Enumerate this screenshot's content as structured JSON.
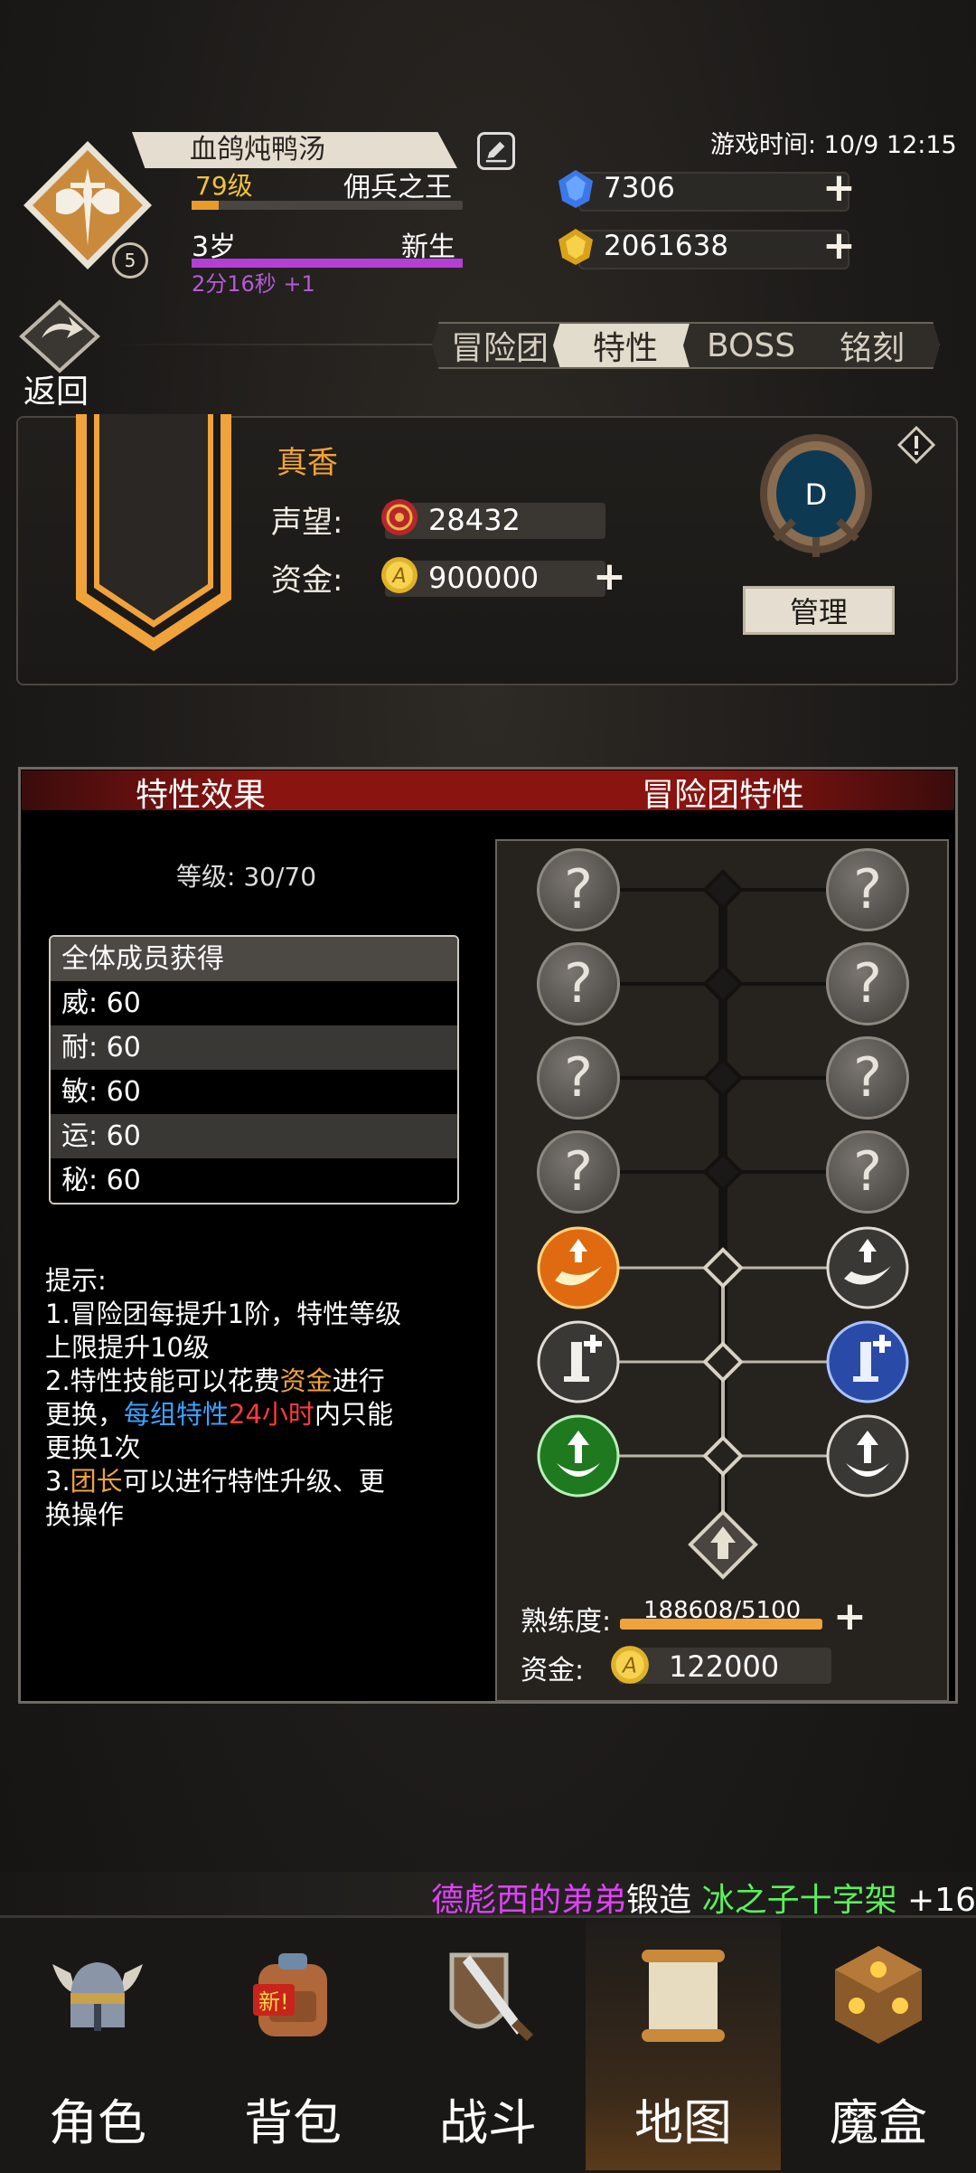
{
  "player": {
    "name": "血鸽炖鸭汤",
    "level": "79级",
    "title": "佣兵之王",
    "rank_badge": "5",
    "age": "3岁",
    "age_status": "新生",
    "timer": "2分16秒 +1",
    "xp_fraction": 0.1
  },
  "game_time": "游戏时间: 10/9 12:15",
  "resources": {
    "gems": "7306",
    "gold": "2061638"
  },
  "back_label": "返回",
  "tabs": [
    "冒险团",
    "特性",
    "BOSS",
    "铭刻"
  ],
  "active_tab": "特性",
  "team": {
    "name": "真香",
    "reputation_label": "声望:",
    "reputation": "28432",
    "funds_label": "资金:",
    "funds": "900000",
    "crest_letter": "D",
    "manage_label": "管理"
  },
  "trait_panel": {
    "effect_header": "特性效果",
    "team_trait_header": "冒险团特性",
    "grade": "等级: 30/70",
    "stats_header": "全体成员获得",
    "stats": [
      "威: 60",
      "耐: 60",
      "敏: 60",
      "运: 60",
      "秘: 60"
    ],
    "tips_title": "提示:",
    "tip1": "1.冒险团每提升1阶，特性等级上限提升10级",
    "tip2_a": "2.特性技能可以花费",
    "tip2_b": "资金",
    "tip2_c": "进行更换，",
    "tip2_d": "每组特性",
    "tip2_e": "24小时",
    "tip2_f": "内只能更换1次",
    "tip3_a": "3.",
    "tip3_b": "团长",
    "tip3_c": "可以进行特性升级、更换操作",
    "proficiency_label": "熟练度:",
    "proficiency": "188608/5100",
    "fund_label": "资金:",
    "fund_value": "122000"
  },
  "ticker": {
    "player": "德彪西的弟弟",
    "action": "锻造 ",
    "item": "冰之子十字架",
    "suffix": " +16"
  },
  "nav": [
    "角色",
    "背包",
    "战斗",
    "地图",
    "魔盒"
  ],
  "nav_active": "地图",
  "bag_badge": "新!",
  "colors": {
    "accent_gold": "#f0a23b",
    "level_yellow": "#f0c23a",
    "purple": "#b53fd6",
    "header_red": "#8a1410"
  }
}
